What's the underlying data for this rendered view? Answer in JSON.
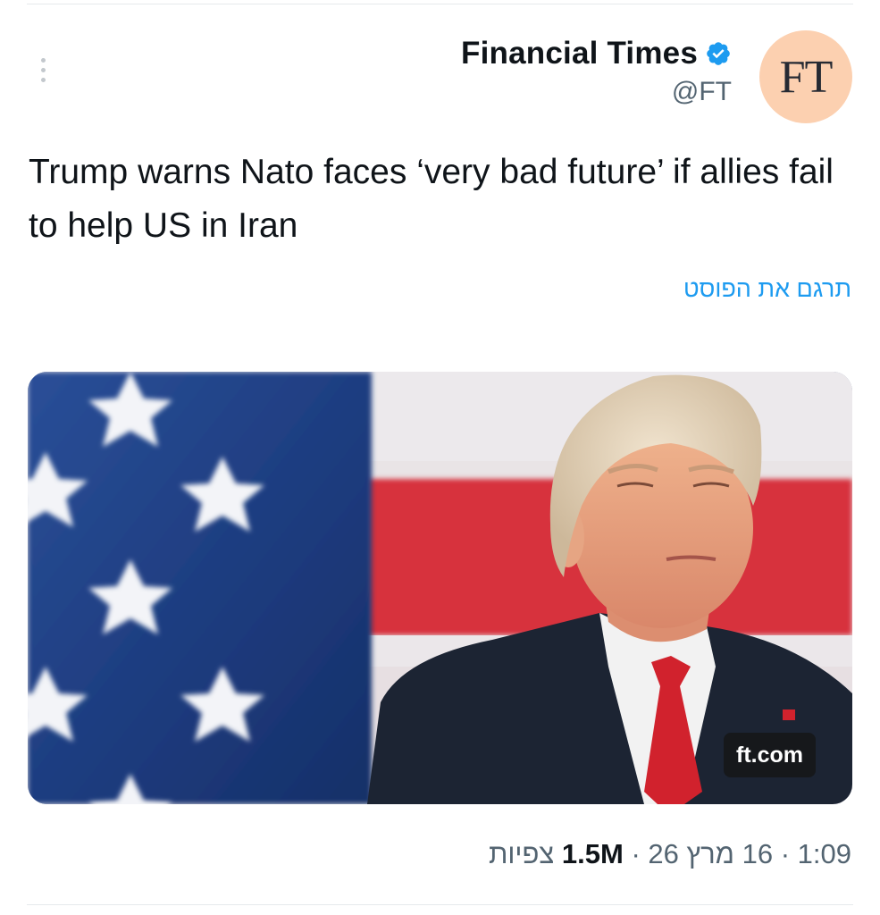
{
  "author": {
    "name": "Financial Times",
    "handle": "@FT",
    "avatar_text": "FT",
    "verified_icon": "verified-badge-icon",
    "avatar_color": "#fcd0b0"
  },
  "post": {
    "text": "Trump warns Nato faces ‘very bad future’ if allies fail to help US in Iran",
    "translate_label": "תרגם את הפוסט"
  },
  "media": {
    "source_label": "ft.com"
  },
  "meta": {
    "time": "1:09",
    "date": "16 מרץ 26",
    "views_count": "1.5M",
    "views_label": "צפיות",
    "separator": "·"
  },
  "colors": {
    "accent": "#1d9bf0",
    "secondary_text": "#536471"
  }
}
